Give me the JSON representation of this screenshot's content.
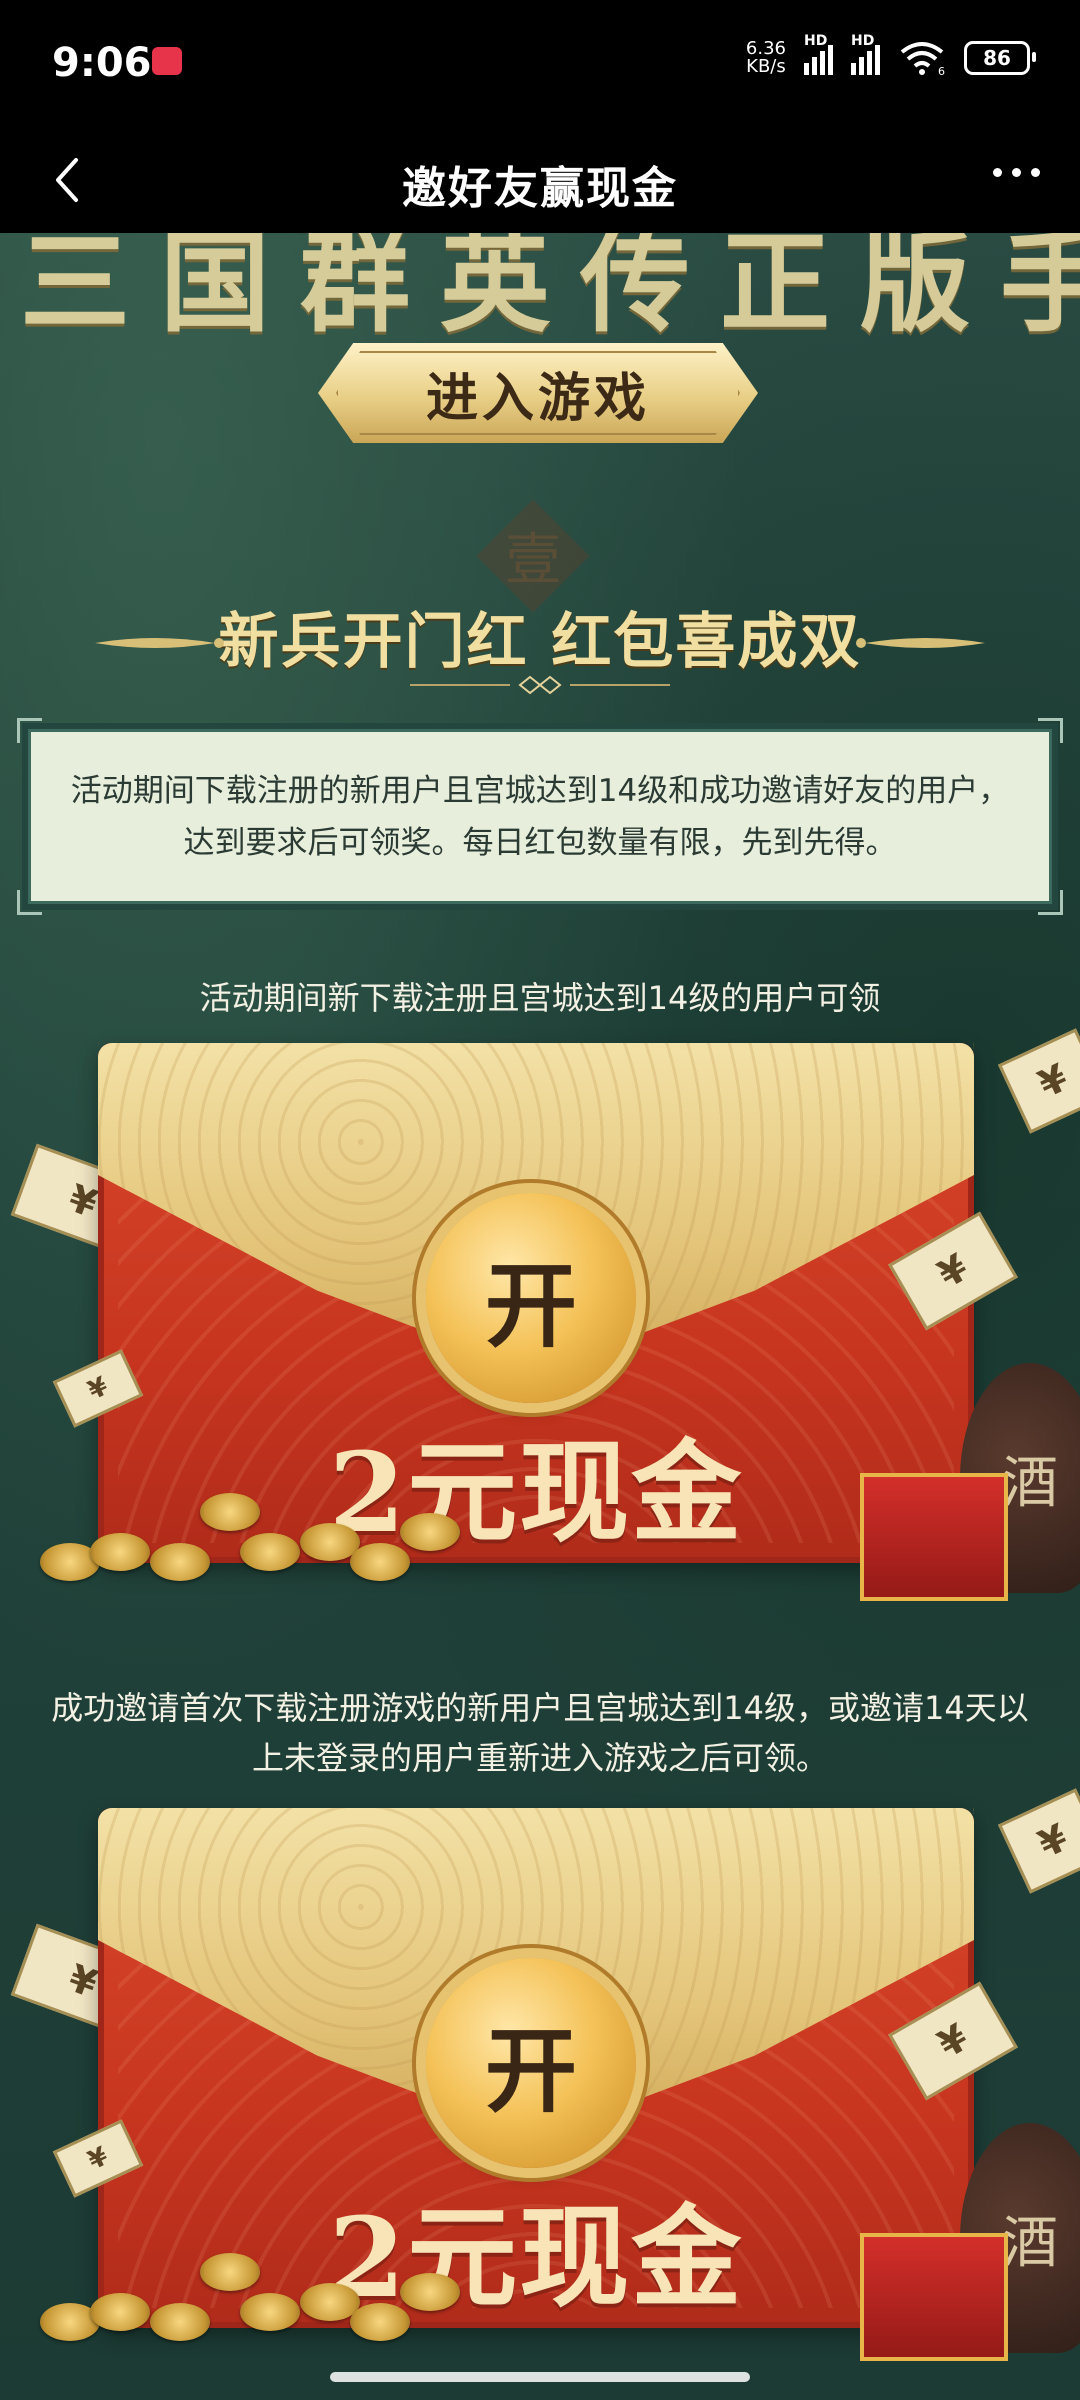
{
  "status_bar": {
    "time": "9:06",
    "net_speed_value": "6.36",
    "net_speed_unit": "KB/s",
    "network_1": "HD",
    "network_2": "HD",
    "wifi_sub": "6",
    "battery": "86"
  },
  "header": {
    "title": "邀好友赢现金"
  },
  "banner": {
    "enter_game_label": "进入游戏",
    "seal_char": "壹"
  },
  "section": {
    "heading": "新兵开门红 红包喜成双",
    "description": "活动期间下载注册的新用户且宫城达到14级和成功邀请好友的用户，达到要求后可领奖。每日红包数量有限，先到先得。"
  },
  "rewards": [
    {
      "caption": "活动期间新下载注册且宫城达到14级的用户可领",
      "open_label": "开",
      "amount": "2元现金"
    },
    {
      "caption": "成功邀请首次下载注册游戏的新用户且宫城达到14级，或邀请14天以上未登录的用户重新进入游戏之后可领。",
      "open_label": "开",
      "amount": "2元现金"
    }
  ],
  "decor": {
    "note_symbol": "¥",
    "jar_char": "酒"
  },
  "colors": {
    "background": "#1f3d36",
    "gold": "#f1dfa1",
    "packet_red": "#c7351f",
    "info_box_bg": "#e7eedc"
  },
  "icons": [
    "back-icon",
    "more-icon",
    "wifi-icon",
    "signal-icon",
    "battery-icon"
  ]
}
